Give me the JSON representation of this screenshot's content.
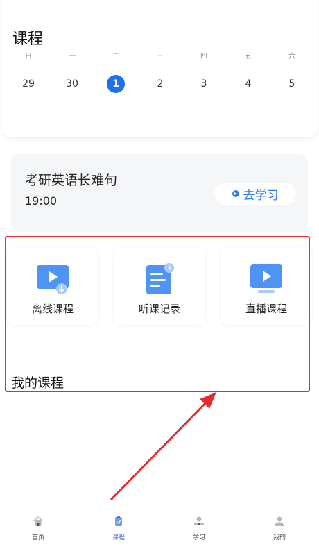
{
  "calendar": {
    "title": "课程",
    "weekdays": [
      "日",
      "一",
      "二",
      "三",
      "四",
      "五",
      "六"
    ],
    "dates": [
      "29",
      "30",
      "1",
      "2",
      "3",
      "4",
      "5"
    ],
    "selected_date": "1"
  },
  "class_card": {
    "name": "考研英语长难句",
    "time": "19:00",
    "action_label": "去学习"
  },
  "features": [
    {
      "label": "离线课程",
      "icon": "offline-video-icon"
    },
    {
      "label": "听课记录",
      "icon": "document-clock-icon"
    },
    {
      "label": "直播课程",
      "icon": "monitor-play-icon"
    }
  ],
  "my_courses": {
    "title": "我的课程"
  },
  "bottom_nav": [
    {
      "label": "首页",
      "icon": "home-icon"
    },
    {
      "label": "课程",
      "icon": "course-icon",
      "active": true
    },
    {
      "label": "学习",
      "icon": "study-icon"
    },
    {
      "label": "我的",
      "icon": "profile-icon"
    }
  ],
  "colors": {
    "accent": "#1f6ff2",
    "highlight_annotation": "#e52b2b",
    "card_bg": "#f5f6f8"
  }
}
